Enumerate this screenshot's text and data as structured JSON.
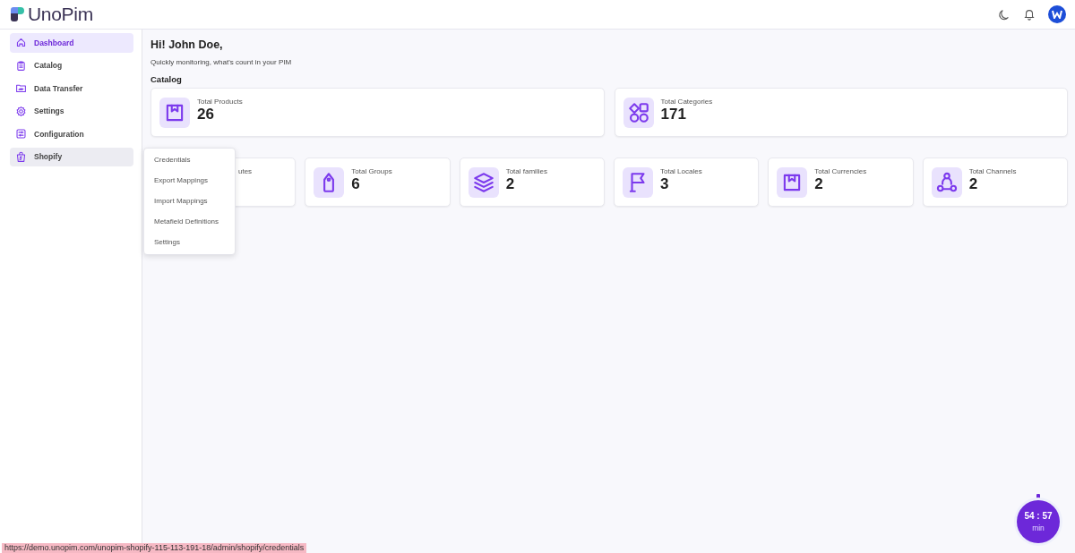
{
  "header": {
    "logo": "UnoPim"
  },
  "sidebar": {
    "items": [
      {
        "label": "Dashboard",
        "selected": true,
        "hovered": false
      },
      {
        "label": "Catalog",
        "selected": false,
        "hovered": false
      },
      {
        "label": "Data Transfer",
        "selected": false,
        "hovered": false
      },
      {
        "label": "Settings",
        "selected": false,
        "hovered": false
      },
      {
        "label": "Configuration",
        "selected": false,
        "hovered": false
      },
      {
        "label": "Shopify",
        "selected": false,
        "hovered": true
      }
    ]
  },
  "flyout_menu": {
    "items": [
      "Credentials",
      "Export Mappings",
      "Import Mappings",
      "Metafield Definitions",
      "Settings"
    ]
  },
  "main": {
    "greeting": "Hi! John Doe,",
    "subtitle": "Quickly monitoring, what's count in your PIM",
    "catalog_heading": "Catalog",
    "catalog_cards": [
      {
        "label": "Total Products",
        "value": "26"
      },
      {
        "label": "Total Categories",
        "value": "171"
      }
    ],
    "structure_cards": [
      {
        "kind": "covered",
        "label": "utes"
      },
      {
        "kind": "stat",
        "label": "Total Groups",
        "value": "6"
      },
      {
        "kind": "stat",
        "label": "Total families",
        "value": "2"
      },
      {
        "kind": "stat",
        "label": "Total Locales",
        "value": "3"
      },
      {
        "kind": "stat",
        "label": "Total Currencies",
        "value": "2"
      },
      {
        "kind": "stat",
        "label": "Total Channels",
        "value": "2"
      }
    ]
  },
  "timer": {
    "time": "54 : 57",
    "unit": "min"
  },
  "status_url": "https://demo.unopim.com/unopim-shopify-115-113-191-18/admin/shopify/credentials"
}
